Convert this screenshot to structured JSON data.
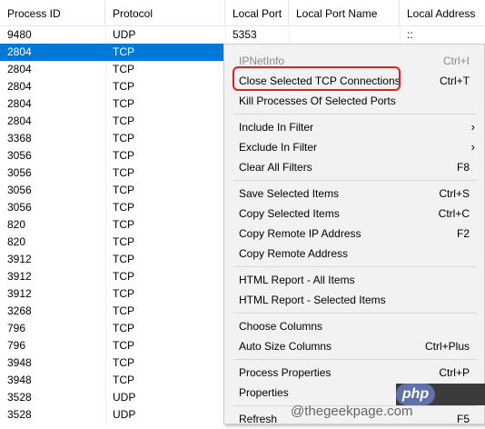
{
  "columns": [
    "Process ID",
    "Protocol",
    "Local Port",
    "Local Port Name",
    "Local Address"
  ],
  "rows": [
    {
      "pid": "9480",
      "proto": "UDP",
      "port": "5353",
      "addr": "::"
    },
    {
      "pid": "2804",
      "proto": "TCP"
    },
    {
      "pid": "2804",
      "proto": "TCP"
    },
    {
      "pid": "2804",
      "proto": "TCP"
    },
    {
      "pid": "2804",
      "proto": "TCP"
    },
    {
      "pid": "2804",
      "proto": "TCP"
    },
    {
      "pid": "3368",
      "proto": "TCP"
    },
    {
      "pid": "3056",
      "proto": "TCP"
    },
    {
      "pid": "3056",
      "proto": "TCP"
    },
    {
      "pid": "3056",
      "proto": "TCP"
    },
    {
      "pid": "3056",
      "proto": "TCP"
    },
    {
      "pid": "820",
      "proto": "TCP"
    },
    {
      "pid": "820",
      "proto": "TCP"
    },
    {
      "pid": "3912",
      "proto": "TCP"
    },
    {
      "pid": "3912",
      "proto": "TCP"
    },
    {
      "pid": "3912",
      "proto": "TCP"
    },
    {
      "pid": "3268",
      "proto": "TCP"
    },
    {
      "pid": "796",
      "proto": "TCP"
    },
    {
      "pid": "796",
      "proto": "TCP"
    },
    {
      "pid": "3948",
      "proto": "TCP"
    },
    {
      "pid": "3948",
      "proto": "TCP"
    },
    {
      "pid": "3528",
      "proto": "UDP"
    },
    {
      "pid": "3528",
      "proto": "UDP"
    }
  ],
  "menu": {
    "items": [
      {
        "label": "IPNetInfo",
        "shortcut": "Ctrl+I",
        "disabled": true
      },
      {
        "label": "Close Selected TCP Connections",
        "shortcut": "Ctrl+T"
      },
      {
        "label": "Kill Processes Of Selected Ports",
        "shortcut": ""
      },
      {
        "label": "Include In Filter",
        "shortcut": ""
      },
      {
        "label": "Exclude In Filter",
        "shortcut": ""
      },
      {
        "label": "Clear All Filters",
        "shortcut": "F8"
      },
      {
        "label": "Save Selected Items",
        "shortcut": "Ctrl+S"
      },
      {
        "label": "Copy Selected Items",
        "shortcut": "Ctrl+C"
      },
      {
        "label": "Copy Remote IP Address",
        "shortcut": "F2"
      },
      {
        "label": "Copy Remote Address",
        "shortcut": ""
      },
      {
        "label": "HTML Report - All Items",
        "shortcut": ""
      },
      {
        "label": "HTML Report - Selected Items",
        "shortcut": ""
      },
      {
        "label": "Choose Columns",
        "shortcut": ""
      },
      {
        "label": "Auto Size Columns",
        "shortcut": "Ctrl+Plus"
      },
      {
        "label": "Process Properties",
        "shortcut": "Ctrl+P"
      },
      {
        "label": "Properties",
        "shortcut": ""
      },
      {
        "label": "Refresh",
        "shortcut": "F5"
      }
    ],
    "submenu_arrow": "›"
  },
  "watermark": {
    "badge": "php",
    "site": "@thegeekpage.com"
  },
  "colors": {
    "selection": "#0078d7",
    "highlight_border": "#e0201e"
  }
}
